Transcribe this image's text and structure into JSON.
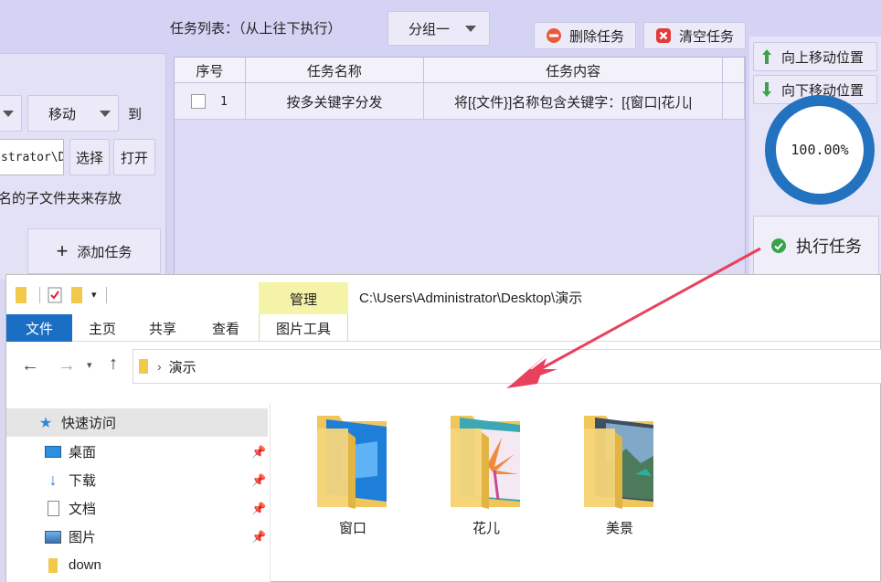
{
  "app": {
    "task_list_label": "任务列表：（从上往下执行）",
    "group_select": "分组一",
    "delete_task": "删除任务",
    "clear_tasks": "清空任务",
    "move_up": "向上移动位置",
    "move_down": "向下移动位置",
    "action_select": "移动",
    "to_label": "到",
    "path_value": "strator\\D",
    "choose_button": "选择",
    "open_button": "打开",
    "subfolder_text": "名的子文件夹来存放",
    "add_task": "添加任务",
    "progress_text": "100.00%",
    "progress_value": 1.0,
    "execute_task": "执行任务",
    "table": {
      "columns": [
        "序号",
        "任务名称",
        "任务内容"
      ],
      "rows": [
        {
          "index": "1",
          "name": "按多关键字分发",
          "content": "将[{文件}]名称包含关键字：[{窗口|花儿|"
        }
      ]
    }
  },
  "explorer": {
    "manage_tab": "管理",
    "path_title": "C:\\Users\\Administrator\\Desktop\\演示",
    "tabs": [
      "文件",
      "主页",
      "共享",
      "查看",
      "图片工具"
    ],
    "breadcrumb": "演示",
    "nav_items": [
      {
        "label": "快速访问",
        "icon": "star-icon"
      },
      {
        "label": "桌面",
        "icon": "desktop-icon"
      },
      {
        "label": "下载",
        "icon": "download-icon"
      },
      {
        "label": "文档",
        "icon": "document-icon"
      },
      {
        "label": "图片",
        "icon": "pictures-icon"
      },
      {
        "label": "down",
        "icon": "folder-icon"
      }
    ],
    "folders": [
      {
        "label": "窗口"
      },
      {
        "label": "花儿"
      },
      {
        "label": "美景"
      }
    ]
  },
  "colors": {
    "app_bg": "#d5d3f3",
    "accent_blue": "#2372c0",
    "file_tab": "#1a6ec3",
    "manage_yellow": "#f5f3a8",
    "arrow_red": "#e8415e"
  }
}
